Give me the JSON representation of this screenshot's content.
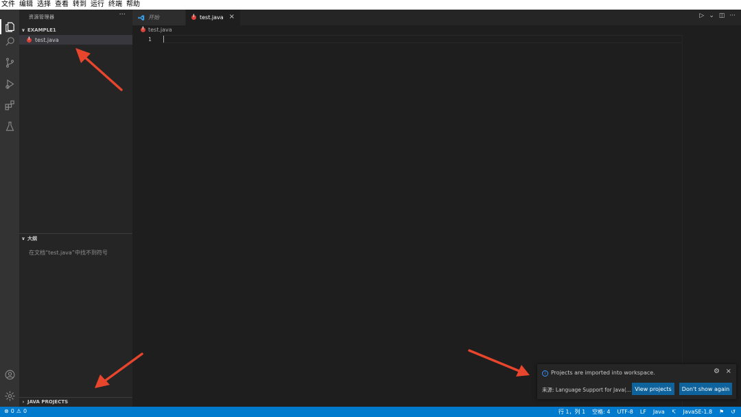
{
  "menu": [
    "文件",
    "编辑",
    "选择",
    "查看",
    "转到",
    "运行",
    "终端",
    "帮助"
  ],
  "sidebar": {
    "title": "资源管理器",
    "more": "···",
    "workspace": "EXAMPLE1",
    "file": "test.java",
    "outline_title": "大纲",
    "outline_message": "在文档“test.java”中找不到符号",
    "java_projects": "JAVA PROJECTS"
  },
  "tabs": [
    {
      "label": "开始"
    },
    {
      "label": "test.java",
      "close": "×"
    }
  ],
  "editor": {
    "breadcrumb": "test.java",
    "line_number": "1"
  },
  "title_actions": {
    "run": "▷",
    "run_menu": "⌄",
    "split": "◫",
    "more": "···"
  },
  "notification": {
    "message": "Projects are imported into workspace.",
    "source": "来源: Language Support for Java(...",
    "gear": "⚙",
    "close": "×",
    "buttons": {
      "view": "View projects",
      "dont": "Don't show again"
    }
  },
  "status": {
    "errors": "0",
    "warnings": "0",
    "position": "行 1，列 1",
    "spaces": "空格: 4",
    "encoding": "UTF-8",
    "eol": "LF",
    "language": "Java",
    "java_version": "JavaSE-1.8"
  },
  "colors": {
    "accent": "#007acc",
    "button": "#0e639c",
    "error": "#d9443a",
    "annotation_arrow": "#e8452d"
  }
}
